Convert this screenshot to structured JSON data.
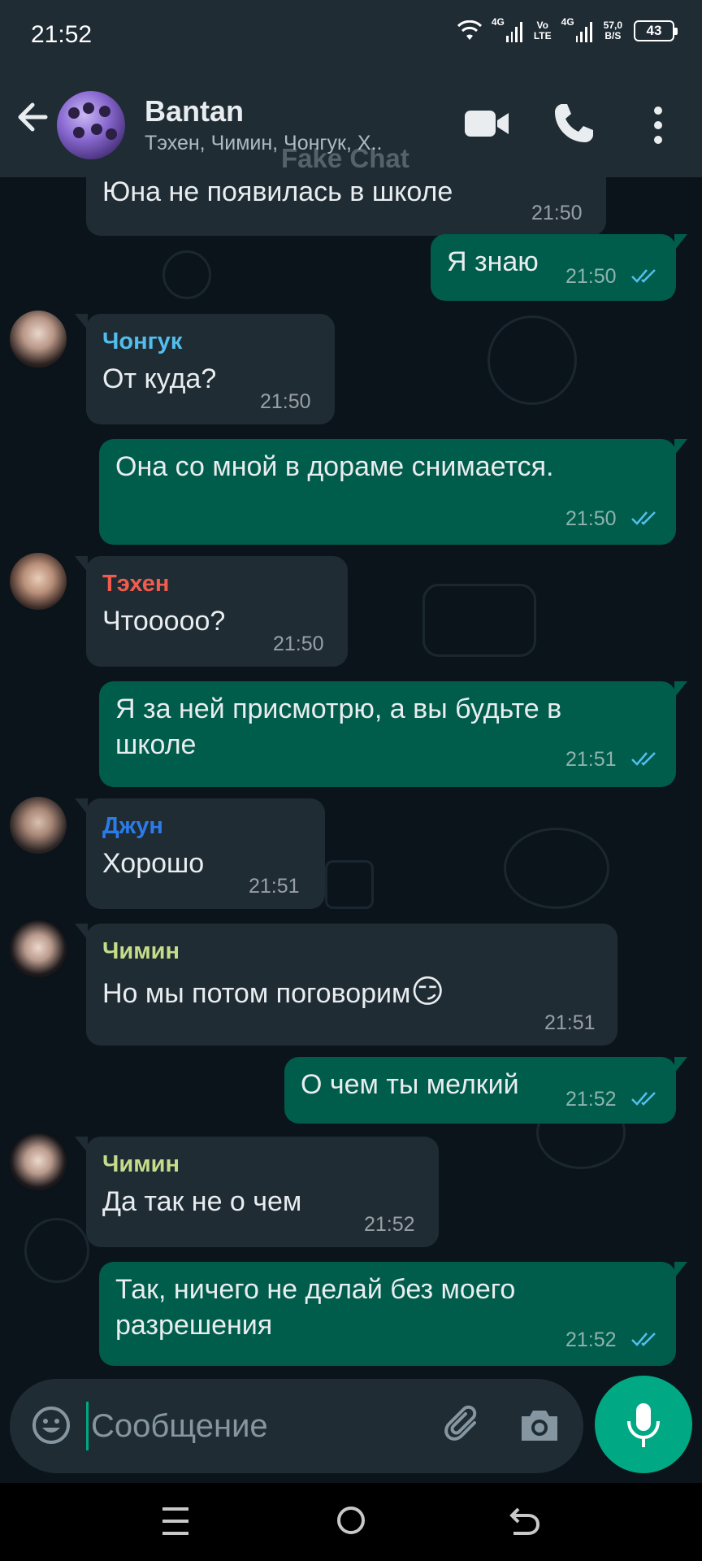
{
  "status_bar": {
    "time": "21:52",
    "network_1": "4G",
    "volte_top": "Vo",
    "volte_bottom": "LTE",
    "network_2": "4G",
    "speed_value": "57,0",
    "speed_unit": "B/S",
    "battery": "43"
  },
  "header": {
    "title": "Bantan",
    "members": "Тэхен, Чимин, Чонгук, Х..",
    "watermark": "Fake Chat"
  },
  "sender_colors": {
    "Чонгук": "#53bdeb",
    "Тэхен": "#f15c4d",
    "Джун": "#2b7ce8",
    "Чимин": "#c5dd8a"
  },
  "colors": {
    "outgoing_bubble": "#005c4b",
    "incoming_bubble": "#1f2c34",
    "read_ticks": "#53bdeb",
    "accent": "#00a884"
  },
  "messages": [
    {
      "direction": "in",
      "text": "Юна не появилась в школе",
      "time": "21:50"
    },
    {
      "direction": "out",
      "text": "Я знаю",
      "time": "21:50",
      "status": "read"
    },
    {
      "direction": "in",
      "sender": "Чонгук",
      "text": "От куда?",
      "time": "21:50"
    },
    {
      "direction": "out",
      "text": "Она со мной в дораме снимается.",
      "time": "21:50",
      "status": "read"
    },
    {
      "direction": "in",
      "sender": "Тэхен",
      "text": "Чтооооо?",
      "time": "21:50"
    },
    {
      "direction": "out",
      "text_line1": "Я за ней присмотрю, а вы будьте в",
      "text_line2": "школе",
      "time": "21:51",
      "status": "read"
    },
    {
      "direction": "in",
      "sender": "Джун",
      "text": "Хорошо",
      "time": "21:51"
    },
    {
      "direction": "in",
      "sender": "Чимин",
      "text": "Но мы потом поговорим",
      "emoji": "😏",
      "time": "21:51"
    },
    {
      "direction": "out",
      "text": "О чем ты мелкий",
      "time": "21:52",
      "status": "read"
    },
    {
      "direction": "in",
      "sender": "Чимин",
      "text": "Да так не о чем",
      "time": "21:52"
    },
    {
      "direction": "out",
      "text_line1": "Так, ничего не делай без моего",
      "text_line2": "разрешения",
      "time": "21:52",
      "status": "read"
    }
  ],
  "input": {
    "placeholder": "Сообщение",
    "value": ""
  },
  "icons": {
    "back": "arrow-left-icon",
    "video": "video-camera-icon",
    "call": "phone-icon",
    "menu": "more-vertical-icon",
    "emoji": "smiley-icon",
    "attach": "paperclip-icon",
    "camera": "camera-icon",
    "mic": "microphone-icon"
  }
}
